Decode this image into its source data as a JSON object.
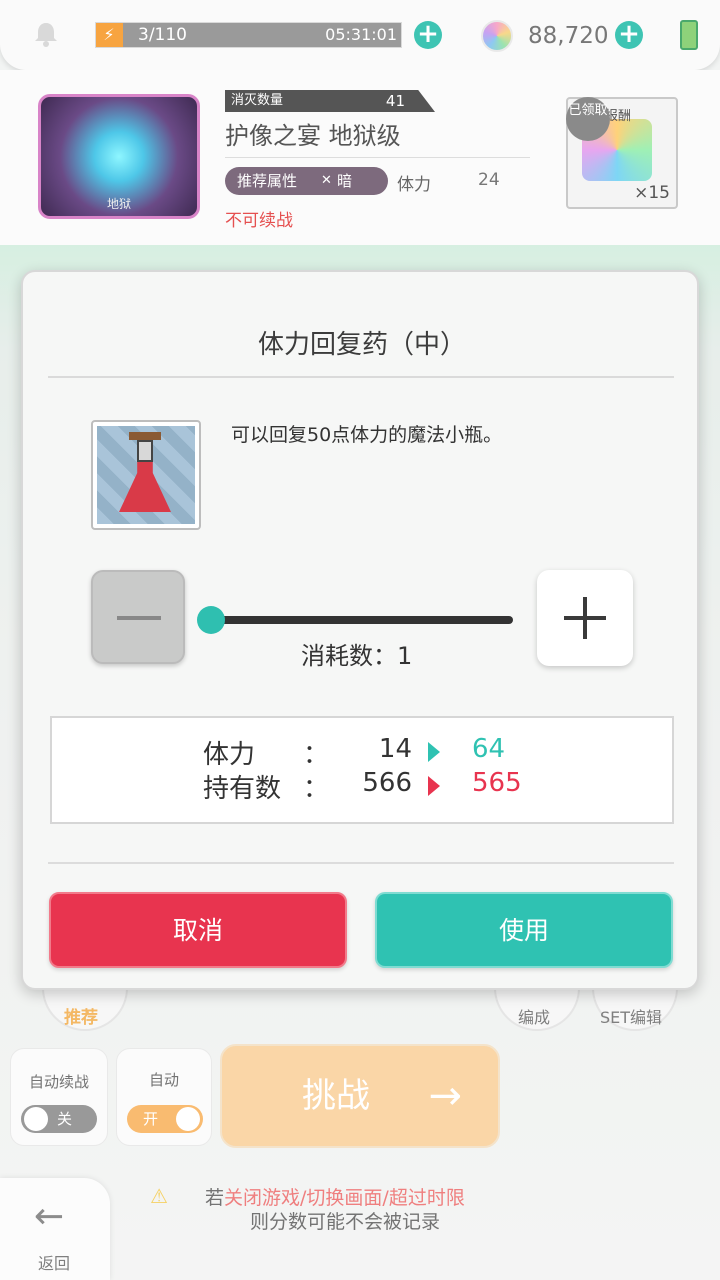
{
  "colors": {
    "accent_teal": "#2fc2b2",
    "cancel_red": "#e8344f",
    "stamina_orange": "#f7a440",
    "decrease_red": "#e8344f"
  },
  "topbar": {
    "stamina_count": "3/110",
    "stamina_timer": "05:31:01",
    "gem_count": "88,720",
    "stamina_fraction": 0.027,
    "icons": [
      "bell-icon",
      "lightning-icon",
      "plus-icon",
      "gem-icon",
      "plus-icon",
      "battery-icon"
    ]
  },
  "quest": {
    "kill_label": "消灭数量",
    "kill_count": "41",
    "title": "护像之宴 地狱级",
    "attr_label": "推荐属性",
    "attr_value": "暗",
    "stamina_label": "体力",
    "stamina_cost": "24",
    "continue_status": "不可续战",
    "boss_label": "地狱",
    "reward_tag": "次报酬",
    "reward_badge": "已领取",
    "reward_count": "×15"
  },
  "dialog": {
    "title": "体力回复药（中）",
    "description": "可以回复50点体力的魔法小瓶。",
    "consume_label": "消耗数：1",
    "slider_value": 1,
    "stats": [
      {
        "label": "体力",
        "colon": "：",
        "from": "14",
        "to": "64",
        "to_color": "#2fc2b2"
      },
      {
        "label": "持有数",
        "colon": "：",
        "from": "566",
        "to": "565",
        "to_color": "#e8344f"
      }
    ],
    "cancel_label": "取消",
    "use_label": "使用"
  },
  "bottom": {
    "recommend_label": "推荐",
    "formation_label": "编成",
    "set_edit_label": "SET编辑",
    "auto_continue_label": "自动续战",
    "auto_continue_state": "关",
    "auto_label": "自动",
    "auto_state": "开",
    "challenge_label": "挑战",
    "back_label": "返回",
    "warning_line1_prefix": "若",
    "warning_line1_red": "关闭游戏/切换画面/超过时限",
    "warning_line2": "则分数可能不会被记录"
  }
}
